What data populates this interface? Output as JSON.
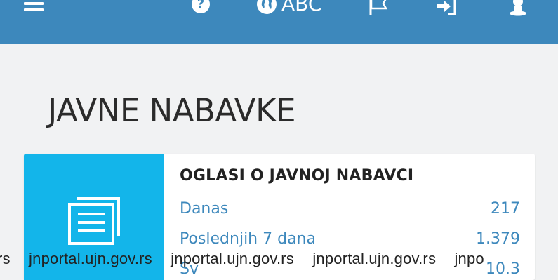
{
  "header": {
    "language_label": "ABC",
    "icons": [
      "menu-icon",
      "help-icon",
      "globe-icon",
      "flag-icon",
      "sign-in-icon",
      "person-icon"
    ],
    "background_color": "#3d88bc"
  },
  "page": {
    "title": "JAVNE NABAVKE"
  },
  "card": {
    "title": "OGLASI O JAVNOJ NABAVCI",
    "accent_color": "#13b5ea",
    "icon": "documents-icon",
    "stats": [
      {
        "label": "Danas",
        "value": "217"
      },
      {
        "label": "Poslednjih 7 dana",
        "value": "1.379"
      },
      {
        "label": "Sv",
        "value": "10.3"
      }
    ]
  },
  "watermark": [
    "rs",
    "jnportal.ujn.gov.rs",
    "jnportal.ujn.gov.rs",
    "jnportal.ujn.gov.rs",
    "jnpo"
  ]
}
